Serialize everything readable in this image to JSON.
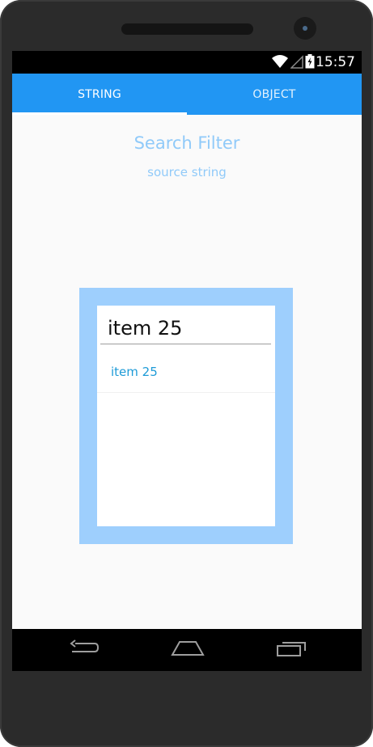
{
  "status_bar": {
    "time": "15:57",
    "icons": [
      "wifi-icon",
      "signal-icon",
      "battery-icon"
    ]
  },
  "tabs": [
    {
      "label": "STRING",
      "selected": true
    },
    {
      "label": "OBJECT",
      "selected": false
    }
  ],
  "header": {
    "title": "Search Filter",
    "subtitle": "source string"
  },
  "filter": {
    "query": "item 25",
    "results": [
      "item 25"
    ]
  },
  "nav_bar": {
    "icons": [
      "back-icon",
      "home-icon",
      "recents-icon"
    ]
  },
  "colors": {
    "accent": "#2196f3",
    "frame": "#9ecffd",
    "title_text": "#90caf9",
    "result_text": "#1e9bd7",
    "background": "#fafafa"
  }
}
